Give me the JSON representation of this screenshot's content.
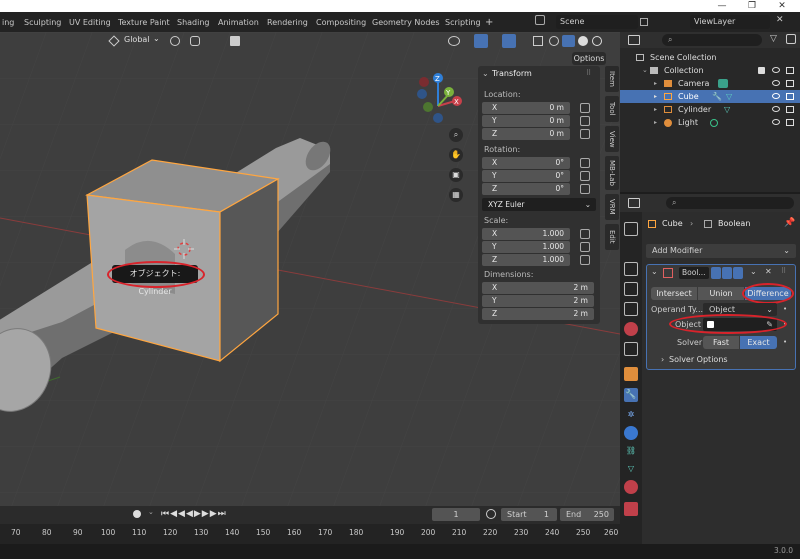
{
  "window": {
    "minimize": "—",
    "maximize": "❐",
    "close": "✕"
  },
  "workspace_tabs": [
    "ing",
    "Sculpting",
    "UV Editing",
    "Texture Paint",
    "Shading",
    "Animation",
    "Rendering",
    "Compositing",
    "Geometry Nodes",
    "Scripting"
  ],
  "add_tab": "+",
  "scene": {
    "name": "Scene",
    "view_layer": "ViewLayer"
  },
  "viewport": {
    "orientation": "Global",
    "options_label": "Options",
    "gizmo_axes": {
      "z": "Z",
      "y": "Y",
      "x": "X"
    },
    "side_tabs": [
      "Item",
      "Tool",
      "View",
      "MB-Lab",
      "VRM",
      "Edit"
    ],
    "tooltip": "オブジェクト: Cylinder"
  },
  "transform": {
    "title": "Transform",
    "location_label": "Location:",
    "location": [
      {
        "axis": "X",
        "value": "0 m"
      },
      {
        "axis": "Y",
        "value": "0 m"
      },
      {
        "axis": "Z",
        "value": "0 m"
      }
    ],
    "rotation_label": "Rotation:",
    "rotation": [
      {
        "axis": "X",
        "value": "0°"
      },
      {
        "axis": "Y",
        "value": "0°"
      },
      {
        "axis": "Z",
        "value": "0°"
      }
    ],
    "rotation_mode": "XYZ Euler",
    "scale_label": "Scale:",
    "scale": [
      {
        "axis": "X",
        "value": "1.000"
      },
      {
        "axis": "Y",
        "value": "1.000"
      },
      {
        "axis": "Z",
        "value": "1.000"
      }
    ],
    "dimensions_label": "Dimensions:",
    "dimensions": [
      {
        "axis": "X",
        "value": "2 m"
      },
      {
        "axis": "Y",
        "value": "2 m"
      },
      {
        "axis": "Z",
        "value": "2 m"
      }
    ]
  },
  "timeline": {
    "current_frame": "1",
    "start_label": "Start",
    "start": "1",
    "end_label": "End",
    "end": "250",
    "ruler": [
      "70",
      "80",
      "90",
      "100",
      "110",
      "120",
      "130",
      "140",
      "150",
      "160",
      "170",
      "180",
      "190",
      "200",
      "210",
      "220",
      "230",
      "240",
      "250",
      "260"
    ]
  },
  "outliner": {
    "root": "Scene Collection",
    "collection": "Collection",
    "items": [
      "Camera",
      "Cube",
      "Cylinder",
      "Light"
    ],
    "selected": "Cube"
  },
  "properties": {
    "object_name": "Cube",
    "modifier_name": "Boolean",
    "add_modifier": "Add Modifier",
    "modifier_short": "Bool...",
    "operations": [
      "Intersect",
      "Union",
      "Difference"
    ],
    "active_operation": "Difference",
    "operand_type_label": "Operand Ty...",
    "operand_type": "Object",
    "object_label": "Object",
    "object_value": "",
    "solver_label": "Solver",
    "solvers": [
      "Fast",
      "Exact"
    ],
    "active_solver": "Exact",
    "solver_options": "Solver Options"
  },
  "status": {
    "version": "3.0.0"
  },
  "colors": {
    "accent": "#4772b3",
    "annotation": "#d9232b",
    "selection": "#ffa640",
    "x_axis": "#c8404a",
    "y_axis": "#7ab13b",
    "z_axis": "#2f7fd8"
  }
}
